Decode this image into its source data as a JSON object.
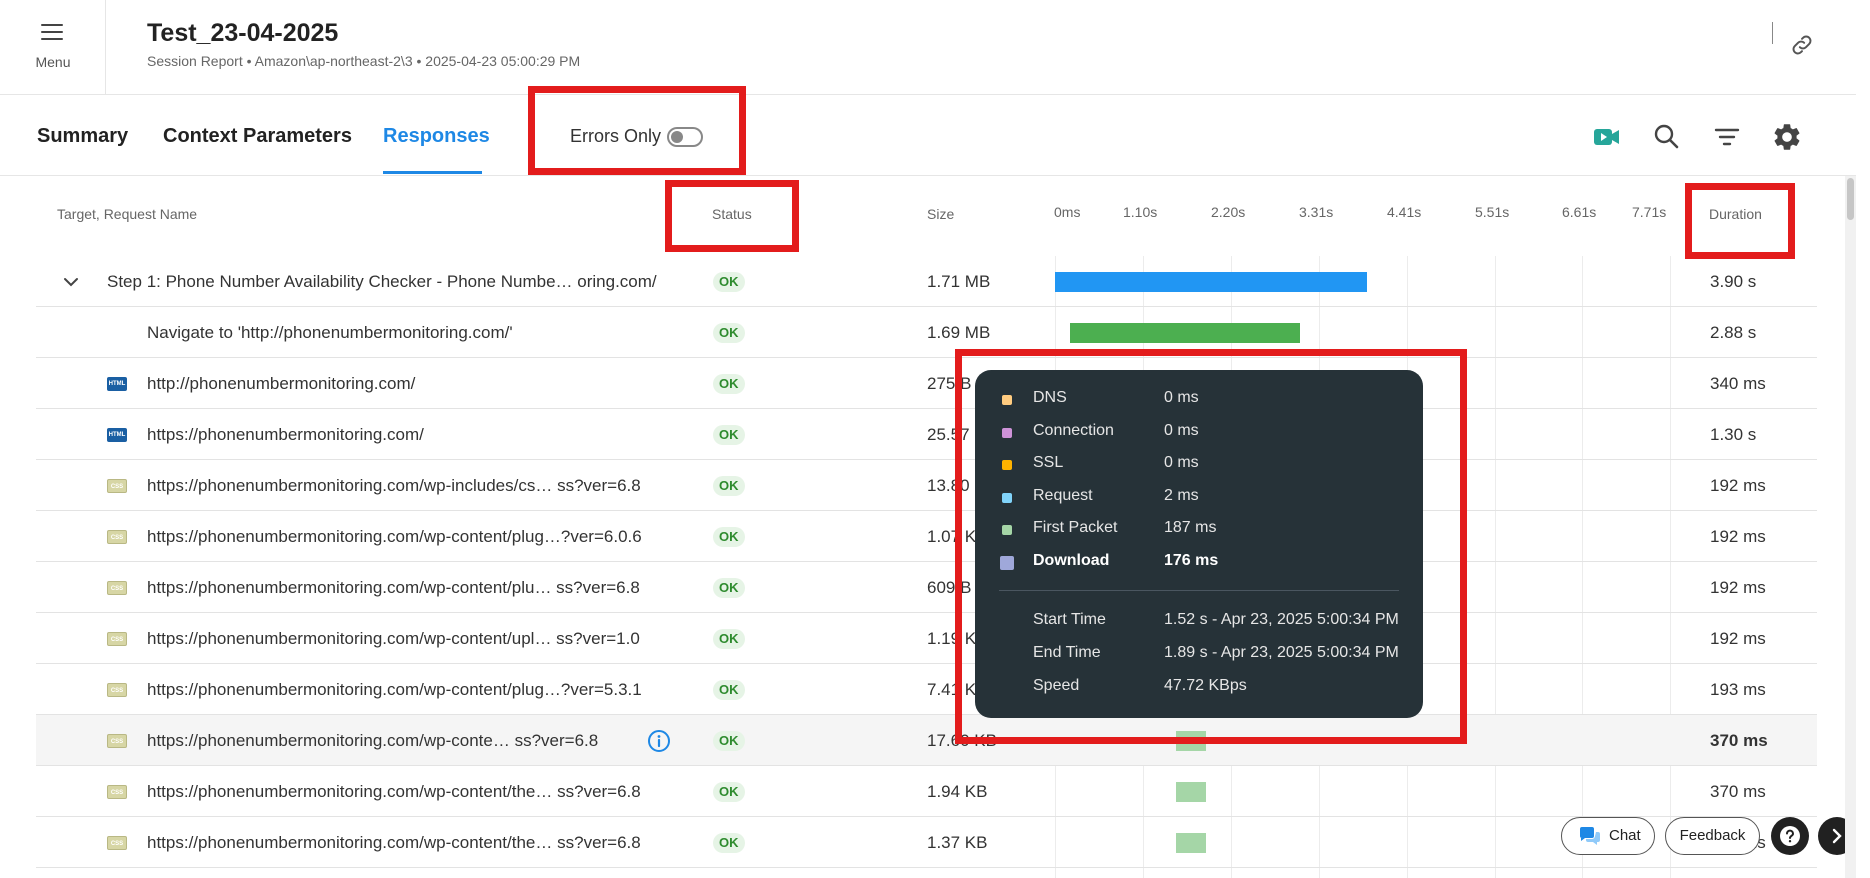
{
  "header": {
    "menu_label": "Menu",
    "title": "Test_23-04-2025",
    "subtitle": "Session Report • Amazon\\ap-northeast-2\\3 • 2025-04-23 05:00:29 PM"
  },
  "tabs": [
    {
      "label": "Summary",
      "active": false
    },
    {
      "label": "Context Parameters",
      "active": false
    },
    {
      "label": "Responses",
      "active": true
    }
  ],
  "toolbar": {
    "errors_only_label": "Errors Only",
    "errors_only_on": false,
    "icons": [
      "video-icon",
      "search-icon",
      "filter-icon",
      "gear-icon"
    ]
  },
  "table": {
    "headers": {
      "name": "Target, Request Name",
      "status": "Status",
      "size": "Size",
      "duration": "Duration"
    },
    "timeline_ticks": [
      "0ms",
      "1.10s",
      "2.20s",
      "3.31s",
      "4.41s",
      "5.51s",
      "6.61s",
      "7.71s"
    ],
    "rows": [
      {
        "name": "Step 1: Phone Number Availability Checker - Phone Numbe… oring.com/",
        "status": "OK",
        "size": "1.71 MB",
        "duration": "3.90 s",
        "icon": "chevron",
        "bar_color": "#2196f3",
        "bar_start_s": 0,
        "bar_end_s": 3.9
      },
      {
        "name": "Navigate to 'http://phonenumbermonitoring.com/'",
        "status": "OK",
        "size": "1.69 MB",
        "duration": "2.88 s",
        "icon": "none",
        "bar_color": "#4caf50",
        "bar_start_s": 0.19,
        "bar_end_s": 3.07
      },
      {
        "name": "http://phonenumbermonitoring.com/",
        "status": "OK",
        "size": "275 B",
        "duration": "340 ms",
        "icon": "html",
        "bar_color": "",
        "bar_start_s": 0,
        "bar_end_s": 0
      },
      {
        "name": "https://phonenumbermonitoring.com/",
        "status": "OK",
        "size": "25.57 KB",
        "duration": "1.30 s",
        "icon": "html",
        "bar_color": "",
        "bar_start_s": 0,
        "bar_end_s": 0
      },
      {
        "name": "https://phonenumbermonitoring.com/wp-includes/cs… ss?ver=6.8",
        "status": "OK",
        "size": "13.80 KB",
        "duration": "192 ms",
        "icon": "css",
        "bar_color": "",
        "bar_start_s": 0,
        "bar_end_s": 0
      },
      {
        "name": "https://phonenumbermonitoring.com/wp-content/plug…?ver=6.0.6",
        "status": "OK",
        "size": "1.07 KB",
        "duration": "192 ms",
        "icon": "css",
        "bar_color": "",
        "bar_start_s": 0,
        "bar_end_s": 0
      },
      {
        "name": "https://phonenumbermonitoring.com/wp-content/plu… ss?ver=6.8",
        "status": "OK",
        "size": "609 B",
        "duration": "192 ms",
        "icon": "css",
        "bar_color": "",
        "bar_start_s": 0,
        "bar_end_s": 0
      },
      {
        "name": "https://phonenumbermonitoring.com/wp-content/upl… ss?ver=1.0",
        "status": "OK",
        "size": "1.19 KB",
        "duration": "192 ms",
        "icon": "css",
        "bar_color": "",
        "bar_start_s": 0,
        "bar_end_s": 0
      },
      {
        "name": "https://phonenumbermonitoring.com/wp-content/plug…?ver=5.3.1",
        "status": "OK",
        "size": "7.41 KB",
        "duration": "193 ms",
        "icon": "css",
        "bar_color": "",
        "bar_start_s": 0,
        "bar_end_s": 0
      },
      {
        "name": "https://phonenumbermonitoring.com/wp-conte… ss?ver=6.8",
        "status": "OK",
        "size": "17.60 KB",
        "duration": "370 ms",
        "icon": "css",
        "bar_color": "#a5d6a7",
        "bar_start_s": 1.52,
        "bar_end_s": 1.89,
        "highlight": true
      },
      {
        "name": "https://phonenumbermonitoring.com/wp-content/the… ss?ver=6.8",
        "status": "OK",
        "size": "1.94 KB",
        "duration": "370 ms",
        "icon": "css",
        "bar_color": "#a5d6a7",
        "bar_start_s": 1.52,
        "bar_end_s": 1.89
      },
      {
        "name": "https://phonenumbermonitoring.com/wp-content/the… ss?ver=6.8",
        "status": "OK",
        "size": "1.37 KB",
        "duration": "370 ms",
        "icon": "css",
        "bar_color": "#a5d6a7",
        "bar_start_s": 1.52,
        "bar_end_s": 1.89
      }
    ]
  },
  "tooltip": {
    "phases": [
      {
        "label": "DNS",
        "value": "0 ms",
        "color": "#ffcc80"
      },
      {
        "label": "Connection",
        "value": "0 ms",
        "color": "#ce93d8"
      },
      {
        "label": "SSL",
        "value": "0 ms",
        "color": "#ffb300"
      },
      {
        "label": "Request",
        "value": "2 ms",
        "color": "#81d4fa"
      },
      {
        "label": "First Packet",
        "value": "187 ms",
        "color": "#a5d6a7"
      },
      {
        "label": "Download",
        "value": "176 ms",
        "color": "#9fa8da"
      }
    ],
    "details": [
      {
        "label": "Start Time",
        "value": "1.52 s - Apr 23, 2025 5:00:34 PM"
      },
      {
        "label": "End Time",
        "value": "1.89 s - Apr 23, 2025 5:00:34 PM"
      },
      {
        "label": "Speed",
        "value": "47.72 KBps"
      }
    ]
  },
  "footer": {
    "chat_label": "Chat",
    "feedback_label": "Feedback"
  },
  "colors": {
    "accent": "#1e88e5",
    "highlight_box": "#e31c1c",
    "ok_badge_bg": "#e6f4e6",
    "ok_badge_text": "#2e8b2e",
    "video_icon": "#26a69a",
    "tooltip_bg": "#263238"
  }
}
